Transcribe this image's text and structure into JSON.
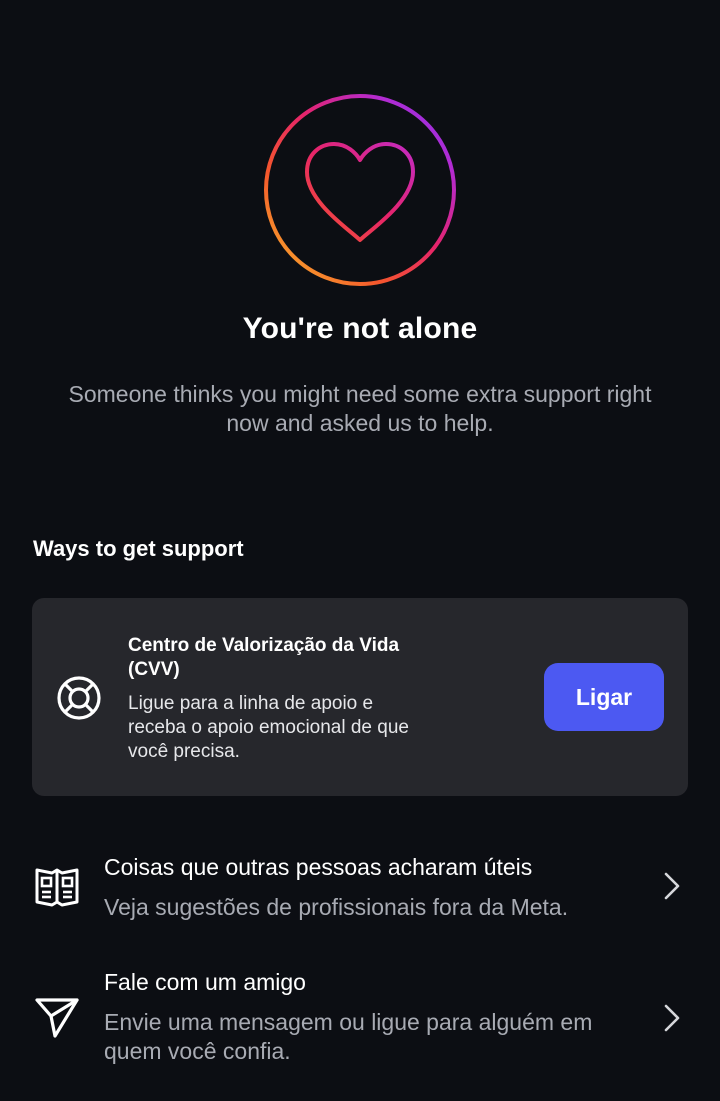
{
  "hero": {
    "icon": "heart-in-gradient-ring-icon",
    "title": "You're not alone",
    "subtitle": "Someone thinks you might need some extra support right now and asked us to help.",
    "gradient_colors": [
      "#f9c02b",
      "#f5572c",
      "#e6246a",
      "#b42bd1",
      "#7e34f0"
    ]
  },
  "support": {
    "heading": "Ways to get support",
    "card": {
      "icon": "lifebuoy-icon",
      "title": "Centro de Valorização da Vida (CVV)",
      "description": "Ligue para a linha de apoio e receba o apoio emocional de que você precisa.",
      "button_label": "Ligar",
      "button_color": "#4c59f2"
    }
  },
  "options": [
    {
      "icon": "guide-book-icon",
      "title": "Coisas que outras pessoas acharam úteis",
      "description": "Veja sugestões de profissionais fora da Meta."
    },
    {
      "icon": "send-paper-plane-icon",
      "title": "Fale com um amigo",
      "description": "Envie uma mensagem ou ligue para alguém em quem você confia."
    }
  ]
}
